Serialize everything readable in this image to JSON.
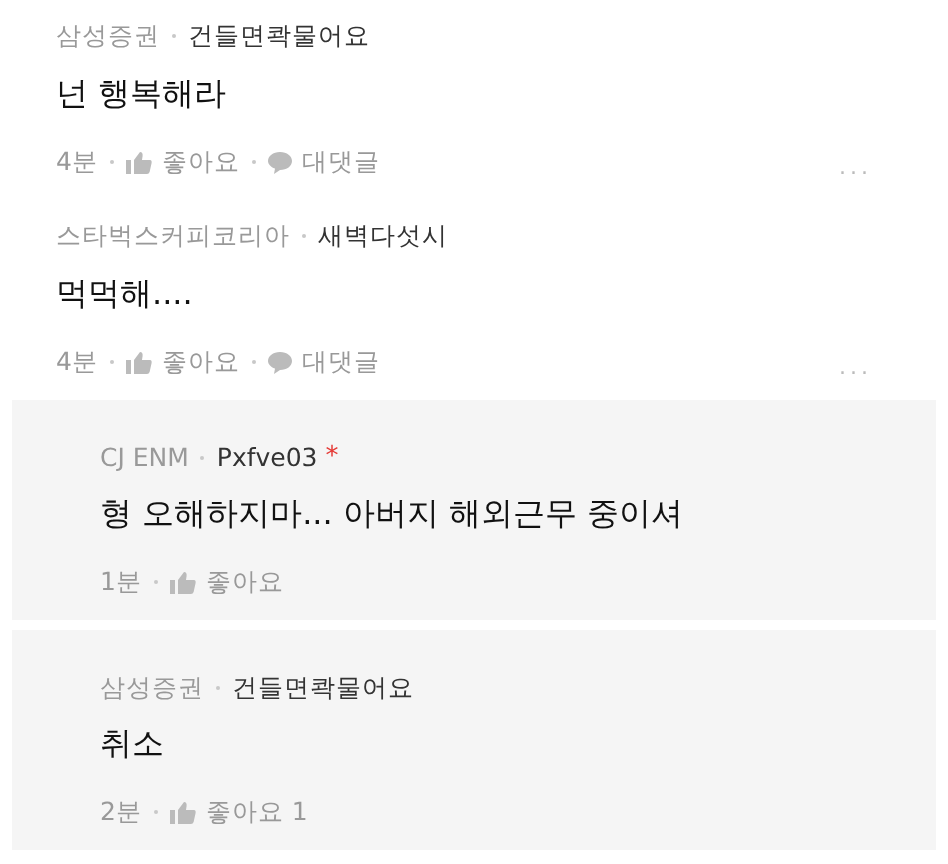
{
  "comments": [
    {
      "kind": "comment",
      "company": "삼성증권",
      "nickname": "건들면콱물어요",
      "body": "넌 행복해라",
      "time": "4분",
      "like": "좋아요",
      "reply": "대댓글",
      "more": "..."
    },
    {
      "kind": "comment",
      "company": "스타벅스커피코리아",
      "nickname": "새벽다섯시",
      "body": "먹먹해....",
      "time": "4분",
      "like": "좋아요",
      "reply": "대댓글",
      "more": "..."
    },
    {
      "kind": "reply",
      "company": "CJ ENM",
      "nickname": "Pxfve03",
      "star": "*",
      "body": "형 오해하지마... 아버지 해외근무 중이셔",
      "time": "1분",
      "like": "좋아요"
    },
    {
      "kind": "reply",
      "company": "삼성증권",
      "nickname": "건들면콱물어요",
      "body": "취소",
      "time": "2분",
      "like": "좋아요 1"
    }
  ]
}
